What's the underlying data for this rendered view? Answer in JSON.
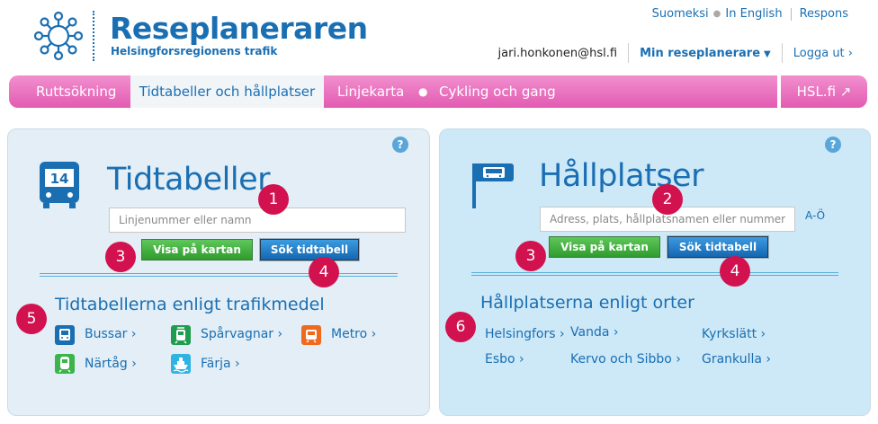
{
  "header": {
    "brand_title": "Reseplaneraren",
    "brand_subtitle": "Helsingforsregionens trafik",
    "lang_finnish": "Suomeksi",
    "lang_english": "In English",
    "feedback": "Respons",
    "user_email": "jari.honkonen@hsl.fi",
    "my_planner": "Min reseplanerare",
    "logout": "Logga ut ›"
  },
  "nav": {
    "items": [
      "Ruttsökning",
      "Tidtabeller och hållplatser",
      "Linjekarta",
      "Cykling och gang"
    ],
    "active": "Tidtabeller och hållplatser",
    "external": "HSL.fi ↗"
  },
  "timetables": {
    "title": "Tidtabeller",
    "route_icon_number": "14",
    "search_placeholder": "Linjenummer eller namn",
    "show_on_map": "Visa på kartan",
    "search_timetable": "Sök tidtabell",
    "section_title": "Tidtabellerna enligt trafikmedel",
    "modes": [
      {
        "label": "Bussar ›",
        "color": "#1a6fb3"
      },
      {
        "label": "Spårvagnar ›",
        "color": "#1f9d4f"
      },
      {
        "label": "Metro ›",
        "color": "#ef6a1c"
      },
      {
        "label": "Närtåg ›",
        "color": "#3ab54a"
      },
      {
        "label": "Färja ›",
        "color": "#2fb3e3"
      }
    ]
  },
  "stops": {
    "title": "Hållplatser",
    "search_placeholder": "Adress, plats, hållplatsnamen eller nummer",
    "az_link": "A-Ö",
    "show_on_map": "Visa på kartan",
    "search_timetable": "Sök tidtabell",
    "section_title": "Hållplatserna enligt orter",
    "cities": [
      "Helsingfors ›",
      "Vanda ›",
      "Kyrkslätt ›",
      "Esbo ›",
      "Kervo och Sibbo ›",
      "Grankulla ›"
    ]
  },
  "help": "?",
  "badges": [
    "1",
    "2",
    "3",
    "3",
    "4",
    "4",
    "5",
    "6"
  ],
  "colors": {
    "brand_blue": "#1a6fb3",
    "nav_pink": "#e25bb2",
    "badge_red": "#d2124f",
    "button_green": "#2e9c2c",
    "button_blue": "#1466b0"
  }
}
